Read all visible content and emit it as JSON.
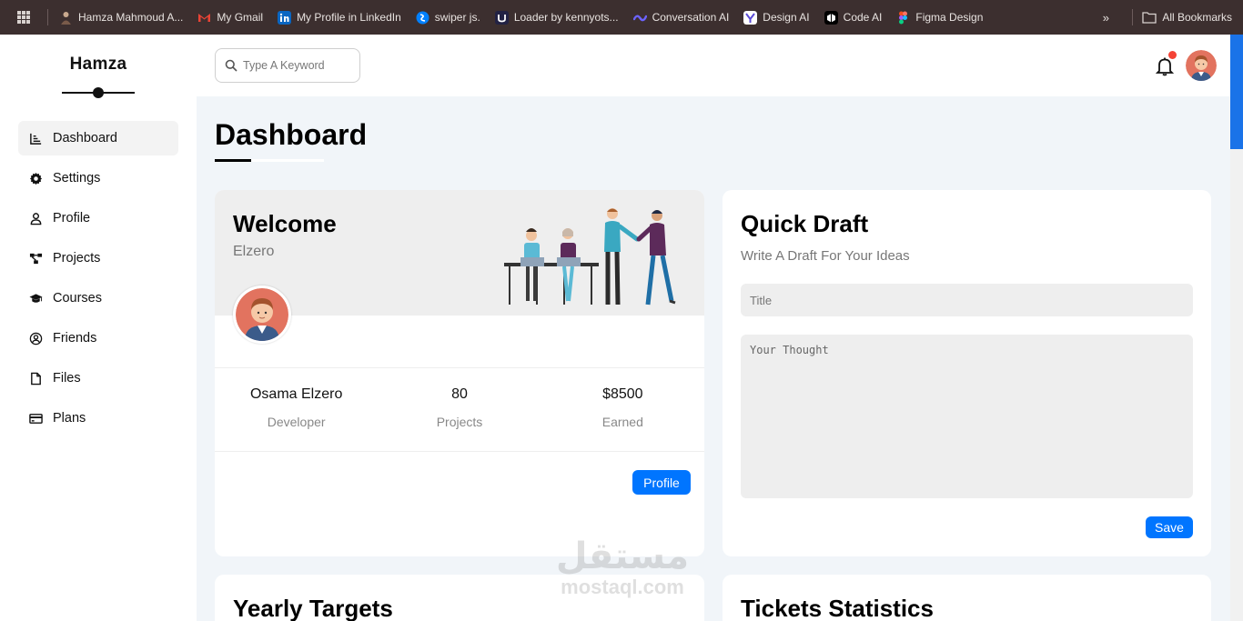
{
  "bookmarks": {
    "items": [
      {
        "label": "Hamza Mahmoud A...",
        "icon": "person-avatar-icon",
        "color": "#7a5b4a"
      },
      {
        "label": "My Gmail",
        "icon": "gmail-icon",
        "color": "#ea4335"
      },
      {
        "label": "My Profile in LinkedIn",
        "icon": "linkedin-icon",
        "color": "#0a66c2"
      },
      {
        "label": "swiper js.",
        "icon": "swiper-icon",
        "color": "#0080ff"
      },
      {
        "label": "Loader by kennyots...",
        "icon": "uiverse-icon",
        "color": "#222244"
      },
      {
        "label": "Conversation AI",
        "icon": "conversation-ai-icon",
        "color": "#6c63ff"
      },
      {
        "label": "Design AI",
        "icon": "design-ai-icon",
        "color": "#ffffff"
      },
      {
        "label": "Code AI",
        "icon": "code-ai-icon",
        "color": "#000000"
      },
      {
        "label": "Figma Design",
        "icon": "figma-icon",
        "color": "#f24e1e"
      }
    ],
    "more": "»",
    "all_bookmarks": "All Bookmarks"
  },
  "sidebar": {
    "brand": "Hamza",
    "items": [
      {
        "label": "Dashboard",
        "icon": "chart-icon",
        "active": true
      },
      {
        "label": "Settings",
        "icon": "gear-icon"
      },
      {
        "label": "Profile",
        "icon": "user-icon"
      },
      {
        "label": "Projects",
        "icon": "diagram-icon"
      },
      {
        "label": "Courses",
        "icon": "graduation-cap-icon"
      },
      {
        "label": "Friends",
        "icon": "circle-user-icon"
      },
      {
        "label": "Files",
        "icon": "file-icon"
      },
      {
        "label": "Plans",
        "icon": "credit-card-icon"
      }
    ]
  },
  "header": {
    "search_placeholder": "Type A Keyword"
  },
  "main": {
    "title": "Dashboard",
    "welcome": {
      "title": "Welcome",
      "subtitle": "Elzero",
      "stats": [
        {
          "value": "Osama Elzero",
          "label": "Developer"
        },
        {
          "value": "80",
          "label": "Projects"
        },
        {
          "value": "$8500",
          "label": "Earned"
        }
      ],
      "button": "Profile"
    },
    "draft": {
      "title": "Quick Draft",
      "subtitle": "Write A Draft For Your Ideas",
      "title_placeholder": "Title",
      "thought_placeholder": "Your Thought",
      "button": "Save"
    },
    "yearly": {
      "title": "Yearly Targets"
    },
    "tickets": {
      "title": "Tickets Statistics"
    }
  },
  "watermark": {
    "arabic": "مستقل",
    "latin": "mostaql.com"
  },
  "colors": {
    "accent": "#0075ff",
    "bookmarks_bg": "#3c2f2f",
    "notification": "#f44336"
  }
}
